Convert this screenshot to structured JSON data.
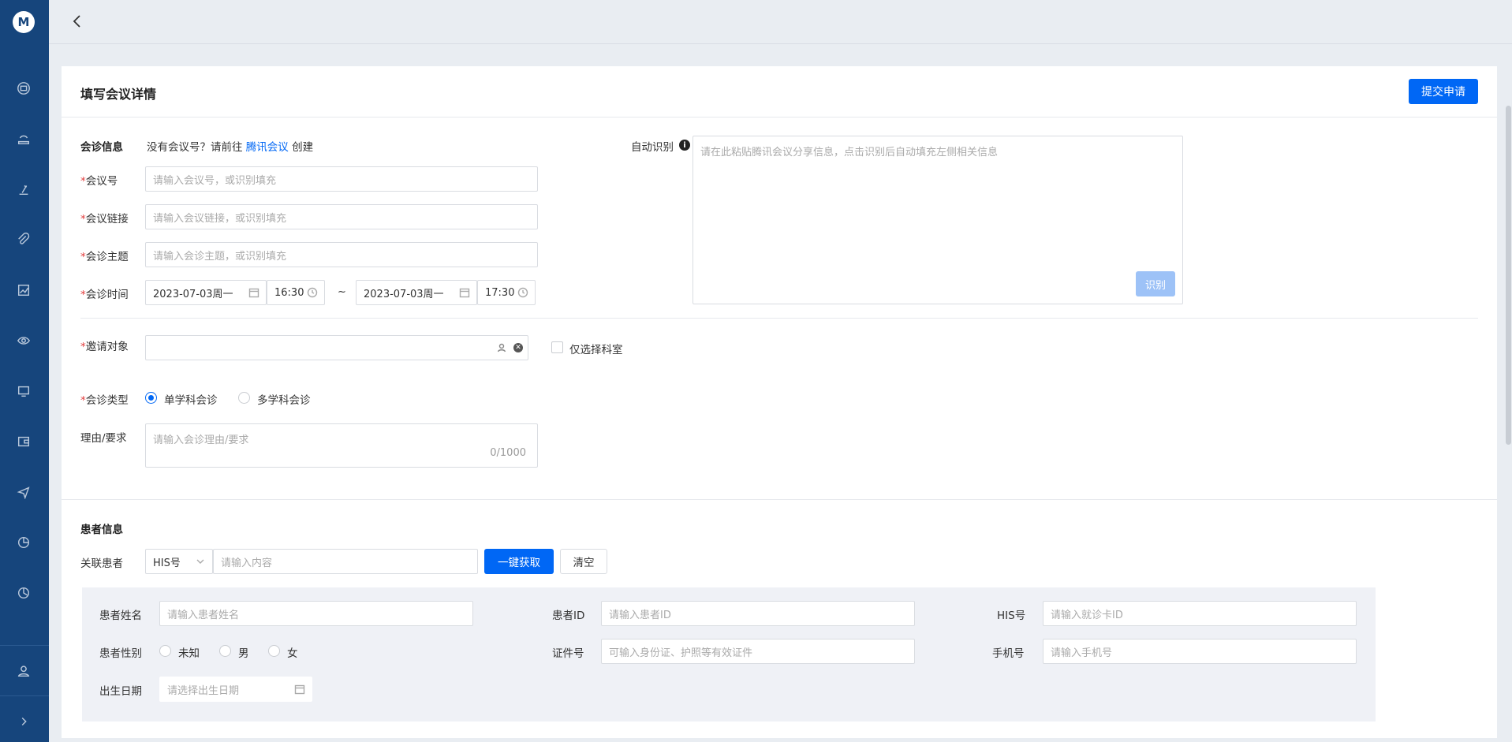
{
  "sidebar": {
    "logo_text": "M",
    "icons": [
      "printer-icon",
      "inbox-icon",
      "microscope-icon",
      "attachment-icon",
      "chart-icon",
      "eye-icon",
      "monitor-icon",
      "wallet-icon",
      "send-icon",
      "pie-chart-icon",
      "clock-chart-icon",
      "user-icon",
      "expand-icon"
    ]
  },
  "header": {
    "back_icon": "chevron-left-icon"
  },
  "card": {
    "title": "填写会议详情",
    "submit_label": "提交申请"
  },
  "meeting": {
    "section_label": "会诊信息",
    "hint_prefix": "没有会议号？请前往",
    "hint_link": "腾讯会议",
    "hint_suffix": "创建",
    "fields": {
      "meeting_no_label": "会议号",
      "meeting_no_placeholder": "请输入会议号，或识别填充",
      "meeting_link_label": "会议链接",
      "meeting_link_placeholder": "请输入会议链接，或识别填充",
      "subject_label": "会诊主题",
      "subject_placeholder": "请输入会诊主题，或识别填充",
      "time_label": "会诊时间",
      "start_date": "2023-07-03周一",
      "start_time": "16:30",
      "separator": "~",
      "end_date": "2023-07-03周一",
      "end_time": "17:30"
    },
    "auto_recognize": {
      "label": "自动识别",
      "info_glyph": "i",
      "placeholder": "请在此粘贴腾讯会议分享信息，点击识别后自动填充左侧相关信息",
      "button": "识别"
    },
    "invite": {
      "label": "邀请对象",
      "value": "",
      "dept_only_label": "仅选择科室"
    },
    "type": {
      "label": "会诊类型",
      "options": [
        "单学科会诊",
        "多学科会诊"
      ],
      "selected": "单学科会诊"
    },
    "reason": {
      "label": "理由/要求",
      "placeholder": "请输入会诊理由/要求",
      "count": "0/1000"
    }
  },
  "patient": {
    "section_label": "患者信息",
    "link_label": "关联患者",
    "id_type": "HIS号",
    "search_placeholder": "请输入内容",
    "fetch_button": "一键获取",
    "clear_button": "清空",
    "fields": {
      "name_label": "患者姓名",
      "name_placeholder": "请输入患者姓名",
      "id_label": "患者ID",
      "id_placeholder": "请输入患者ID",
      "his_label": "HIS号",
      "his_placeholder": "请输入就诊卡ID",
      "gender_label": "患者性别",
      "gender_options": [
        "未知",
        "男",
        "女"
      ],
      "cert_label": "证件号",
      "cert_placeholder": "可输入身份证、护照等有效证件",
      "phone_label": "手机号",
      "phone_placeholder": "请输入手机号",
      "birth_label": "出生日期",
      "birth_placeholder": "请选择出生日期"
    }
  },
  "colors": {
    "primary": "#0067f5",
    "sidebar": "#16457c",
    "required": "#e23c3c"
  }
}
